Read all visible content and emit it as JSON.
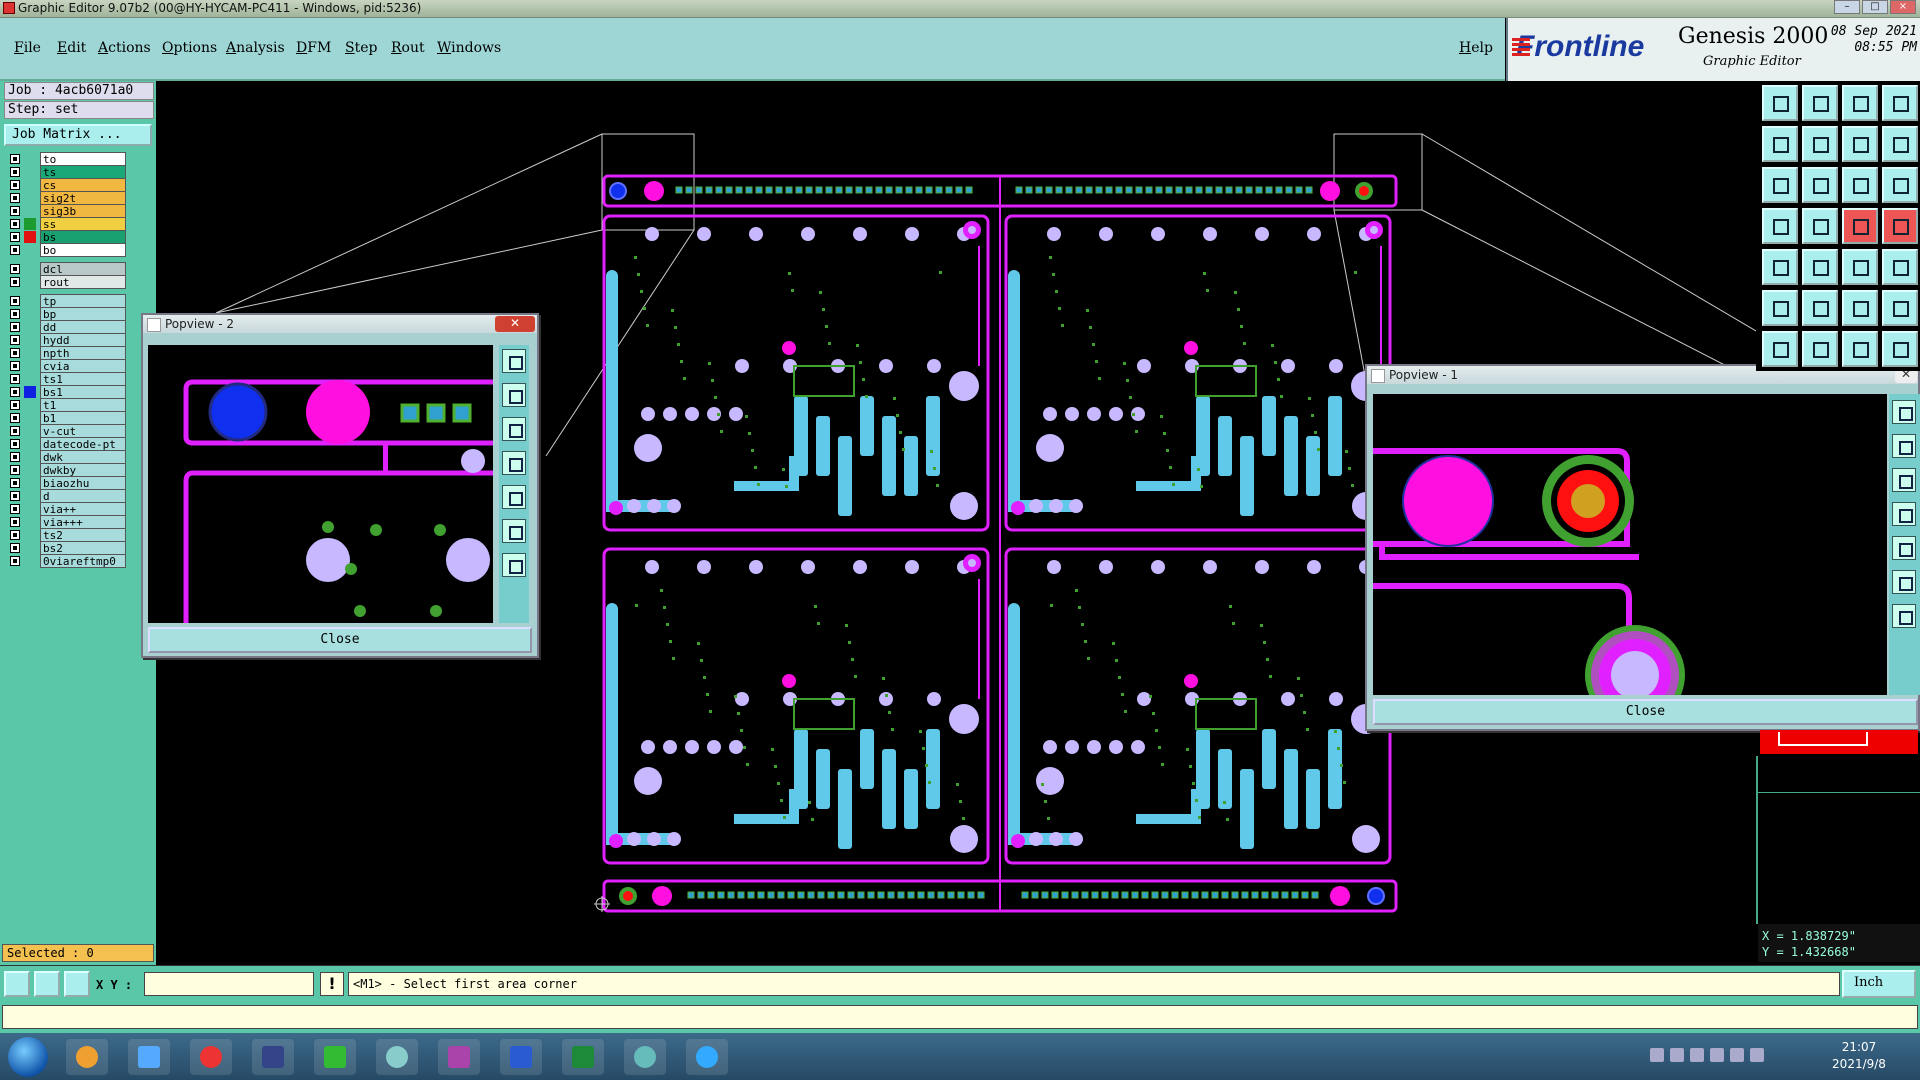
{
  "window": {
    "title": "Graphic Editor 9.07b2 (00@HY-HYCAM-PC411 - Windows, pid:5236)"
  },
  "menu": {
    "items": [
      "File",
      "Edit",
      "Actions",
      "Options",
      "Analysis",
      "DFM",
      "Step",
      "Rout",
      "Windows"
    ],
    "help": "Help"
  },
  "brand": {
    "logo": "Frontline",
    "product": "Genesis 2000",
    "subtitle": "Graphic Editor",
    "date": "08 Sep 2021",
    "time": "08:55 PM"
  },
  "job": {
    "line": "Job : 4acb6071a0",
    "step": "Step: set",
    "matrix_button": "Job Matrix ..."
  },
  "layers": [
    {
      "name": "to",
      "color": "#ffffff",
      "swatch": ""
    },
    {
      "name": "ts",
      "color": "#1aa878",
      "swatch": ""
    },
    {
      "name": "cs",
      "color": "#f0b840",
      "swatch": ""
    },
    {
      "name": "sig2t",
      "color": "#f0b840",
      "swatch": ""
    },
    {
      "name": "sig3b",
      "color": "#f0b840",
      "swatch": ""
    },
    {
      "name": "ss",
      "color": "#f0d040",
      "swatch": "#1c9c30"
    },
    {
      "name": "bs",
      "color": "#18a070",
      "swatch": "#e01010"
    },
    {
      "name": "bo",
      "color": "#ffffff",
      "swatch": ""
    },
    {
      "name": "dcl",
      "color": "#b8c8c8",
      "swatch": ""
    },
    {
      "name": "rout",
      "color": "#e0e8e8",
      "swatch": ""
    },
    {
      "name": "tp",
      "color": "#a8dcdc",
      "swatch": ""
    },
    {
      "name": "bp",
      "color": "#a8dcdc",
      "swatch": ""
    },
    {
      "name": "dd",
      "color": "#a8dcdc",
      "swatch": ""
    },
    {
      "name": "hydd",
      "color": "#a8dcdc",
      "swatch": ""
    },
    {
      "name": "npth",
      "color": "#a8dcdc",
      "swatch": ""
    },
    {
      "name": "cvia",
      "color": "#a8dcdc",
      "swatch": ""
    },
    {
      "name": "ts1",
      "color": "#a8dcdc",
      "swatch": ""
    },
    {
      "name": "bs1",
      "color": "#a8dcdc",
      "swatch": "#1020e0"
    },
    {
      "name": "t1",
      "color": "#a8dcdc",
      "swatch": ""
    },
    {
      "name": "b1",
      "color": "#a8dcdc",
      "swatch": ""
    },
    {
      "name": "v-cut",
      "color": "#a8dcdc",
      "swatch": ""
    },
    {
      "name": "datecode-pt",
      "color": "#a8dcdc",
      "swatch": ""
    },
    {
      "name": "dwk",
      "color": "#a8dcdc",
      "swatch": ""
    },
    {
      "name": "dwkby",
      "color": "#a8dcdc",
      "swatch": ""
    },
    {
      "name": "biaozhu",
      "color": "#a8dcdc",
      "swatch": ""
    },
    {
      "name": "d",
      "color": "#a8dcdc",
      "swatch": ""
    },
    {
      "name": "via++",
      "color": "#a8dcdc",
      "swatch": ""
    },
    {
      "name": "via+++",
      "color": "#a8dcdc",
      "swatch": ""
    },
    {
      "name": "ts2",
      "color": "#a8dcdc",
      "swatch": ""
    },
    {
      "name": "bs2",
      "color": "#a8dcdc",
      "swatch": ""
    },
    {
      "name": "0viareftmp0",
      "color": "#a8dcdc",
      "swatch": ""
    }
  ],
  "selected": "Selected : 0",
  "popview2": {
    "title": "Popview - 2",
    "close": "Close"
  },
  "popview1": {
    "title": "Popview - 1",
    "close": "Close"
  },
  "coords": {
    "x": "X = 1.838729\"",
    "y": "Y = 1.432668\""
  },
  "command": {
    "xy_label": "X Y :",
    "xy_value": "",
    "info": "!",
    "prompt": "<M1> - Select first area corner",
    "units": "Inch"
  },
  "taskbar": {
    "time": "21:07",
    "date": "2021/9/8"
  },
  "colors": {
    "outline": "#e020ff",
    "copper": "#60c8e8",
    "pad": "#c8b8ff",
    "dot": "#40a030"
  }
}
